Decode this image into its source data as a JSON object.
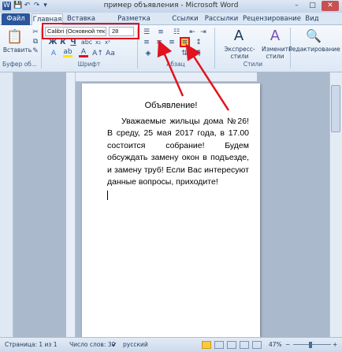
{
  "window": {
    "title": "пример объявления - Microsoft Word",
    "controls": {
      "minimize": "–",
      "maximize": "□",
      "close": "✕"
    },
    "quick_access": [
      "W",
      "💾",
      "↶",
      "↷",
      "▾"
    ]
  },
  "tabs": [
    {
      "label": "Файл"
    },
    {
      "label": "Главная"
    },
    {
      "label": "Вставка"
    },
    {
      "label": "Разметка страницы"
    },
    {
      "label": "Ссылки"
    },
    {
      "label": "Рассылки"
    },
    {
      "label": "Рецензирование"
    },
    {
      "label": "Вид"
    }
  ],
  "ribbon": {
    "paste_label": "Вставить",
    "font_name": "Calibri (Основной тек",
    "font_size": "28",
    "groups": {
      "clipboard": "Буфер об...",
      "font": "Шрифт",
      "paragraph": "Абзац",
      "styles": "Стили"
    },
    "express_styles": "Экспресс-стили",
    "change_styles": "Изменить стили",
    "editing": "Редактирование",
    "format_buttons": [
      "Ж",
      "К",
      "Ч"
    ]
  },
  "document": {
    "heading": "Объявление!",
    "body": "Уважаемые жильцы дома №26! В среду, 25 мая 2017 года, в 17.00 состоится собрание! Будем обсуждать замену окон в подъезде, и замену труб! Если Вас интересуют данные вопросы, приходите!"
  },
  "status": {
    "page": "Страница: 1 из 1",
    "words": "Число слов: 30",
    "language": "русский",
    "zoom": "47%"
  },
  "accent": {
    "ribbon_blue": "#2b579a",
    "annotation_red": "#e0141e",
    "highlight": "#ffc83d"
  }
}
